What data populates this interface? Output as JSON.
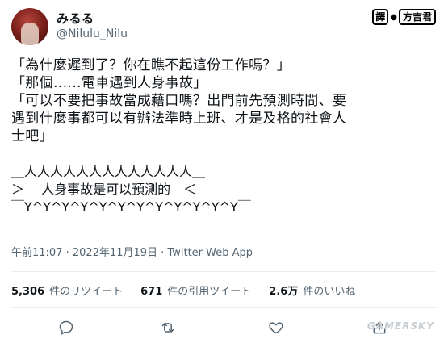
{
  "user": {
    "display_name": "みるる",
    "handle": "@Nilulu_Nilu",
    "avatar": "avatar-photo"
  },
  "translator_badge": {
    "prefix": "譯",
    "separator": "●",
    "name": "方吉君"
  },
  "tweet": {
    "lines": [
      "「為什麼遲到了？你在瞧不起這份工作嗎？」",
      "「那個‥‥‥電車遇到人身事故」",
      "「可以不要把事故當成藉口嗎？出門前先預測時間、要",
      "遇到什麼事都可以有辦法準時上班、才是及格的社會人",
      "士吧」"
    ],
    "ascii": [
      "＿人人人人人人人人人人人人人＿",
      "＞　 人身事故是可以預測的　＜",
      "￣Y^Y^Y^Y^Y^Y^Y^Y^Y^Y^Y^Y￣"
    ]
  },
  "meta": {
    "time": "午前11:07",
    "separator": " · ",
    "date": "2022年11月19日",
    "client": "Twitter Web App"
  },
  "stats": {
    "retweets_count": "5,306",
    "retweets_label": "件のリツイート",
    "quotes_count": "671",
    "quotes_label": "件の引用ツイート",
    "likes_count": "2.6万",
    "likes_label": "件のいいね"
  },
  "actions": {
    "reply_icon": "reply-icon",
    "retweet_icon": "retweet-icon",
    "like_icon": "heart-icon",
    "share_icon": "share-icon"
  },
  "watermark": "GAMERSKY"
}
